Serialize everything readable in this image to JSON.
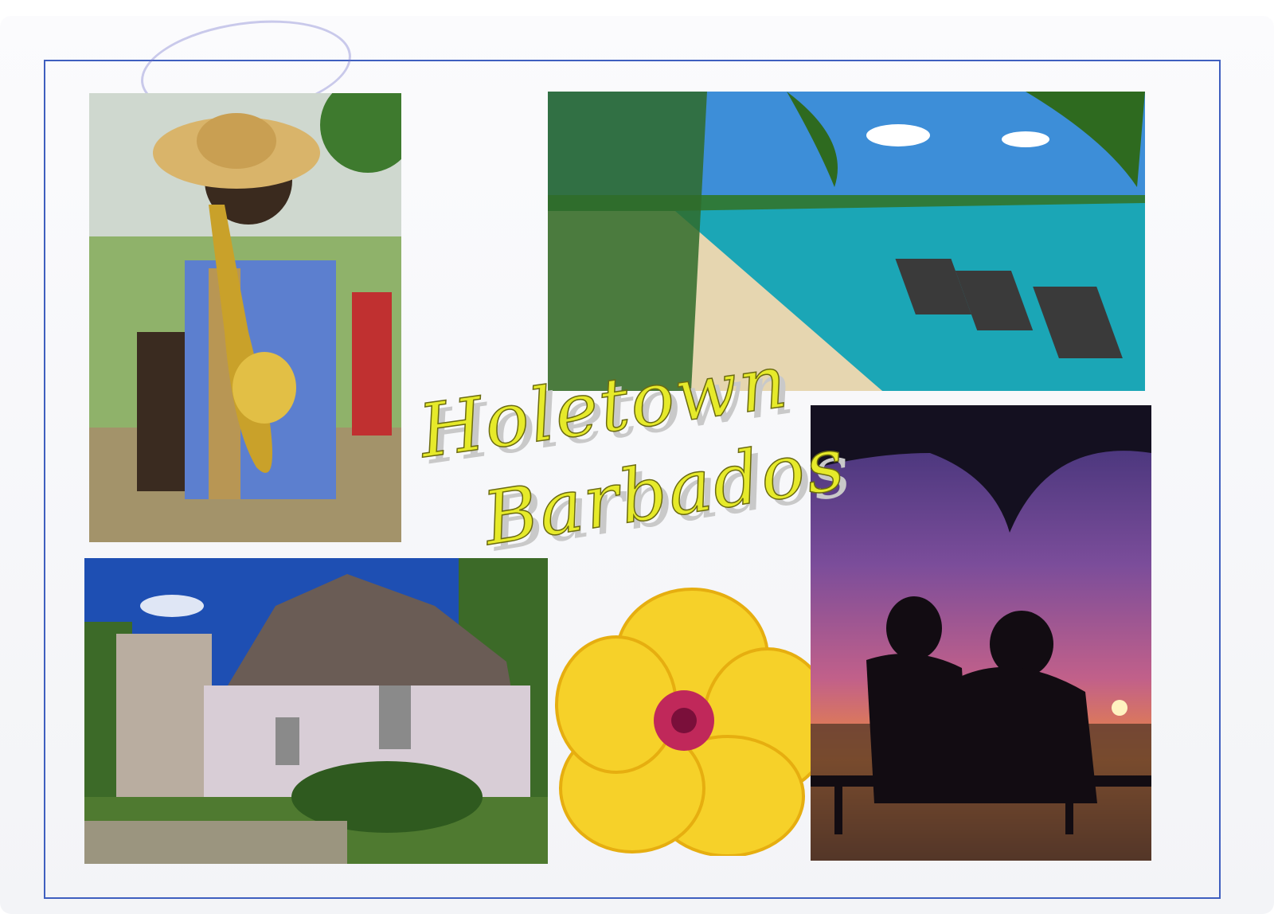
{
  "postcard": {
    "title_line1": "Holetown",
    "title_line2": "Barbados"
  },
  "photos": {
    "saxophonist": "saxophone-player",
    "beach": "beach-lounge-chairs",
    "church": "stone-church",
    "hibiscus": "yellow-hibiscus",
    "sunset": "couple-at-sunset"
  },
  "colors": {
    "border": "#3f5fbf",
    "title_fill": "#e6ea2a",
    "title_outline": "#6b6b10"
  }
}
